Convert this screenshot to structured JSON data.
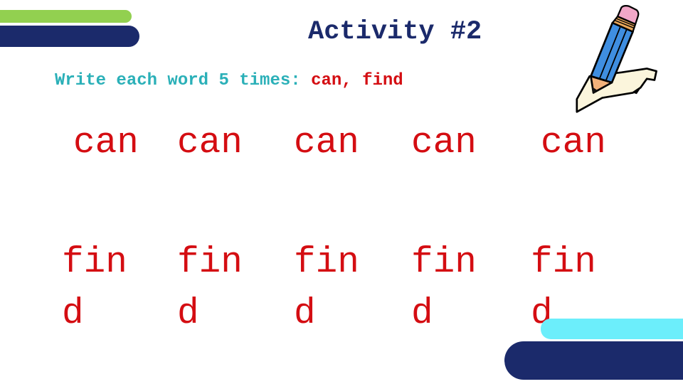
{
  "title": "Activity #2",
  "instructions": {
    "lead": "Write each word 5 times: ",
    "words": "can, find"
  },
  "practice": {
    "can_row": [
      "can",
      "can",
      "can",
      "can",
      "can"
    ],
    "find_row": [
      "fin\nd",
      "fin\nd",
      "fin\nd",
      "fin\nd",
      "fin\nd"
    ]
  },
  "colors": {
    "title": "#1b2a6b",
    "instruction_text": "#2bb0b8",
    "target_words": "#d40d12",
    "green_accent": "#92d050",
    "navy_accent": "#1b2a6b",
    "cyan_accent": "#6ceefb"
  },
  "illustration": {
    "icon": "pencil-writing-on-paper-icon"
  }
}
